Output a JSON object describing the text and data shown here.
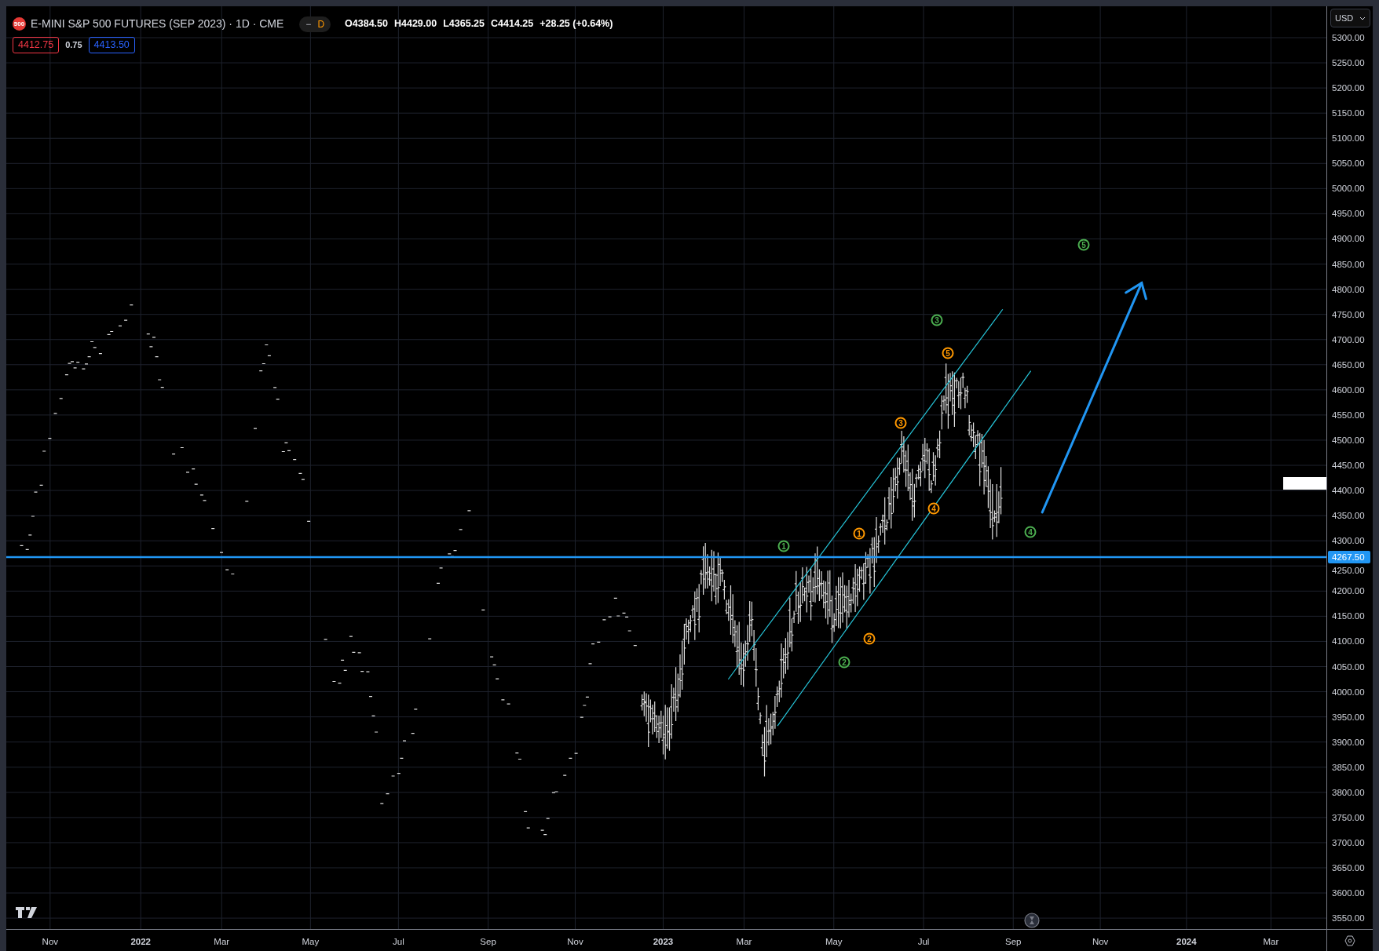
{
  "header": {
    "symbol_badge": "500",
    "title": "E-MINI S&P 500 FUTURES (SEP 2023) · 1D · CME",
    "pill_dash": "−",
    "pill_letter": "D",
    "ohlc": [
      {
        "label": "O",
        "value": "4384.50"
      },
      {
        "label": "H",
        "value": "4429.00"
      },
      {
        "label": "L",
        "value": "4365.25"
      },
      {
        "label": "C",
        "value": "4414.25"
      }
    ],
    "change": "+28.25 (+0.64%)",
    "bid": "4412.75",
    "spread": "0.75",
    "ask": "4413.50"
  },
  "currency": "USD",
  "price_axis": [
    "5300.00",
    "5250.00",
    "5200.00",
    "5150.00",
    "5100.00",
    "5050.00",
    "5000.00",
    "4950.00",
    "4900.00",
    "4850.00",
    "4800.00",
    "4750.00",
    "4700.00",
    "4650.00",
    "4600.00",
    "4550.00",
    "4500.00",
    "4450.00",
    "4400.00",
    "4350.00",
    "4300.00",
    "4250.00",
    "4200.00",
    "4150.00",
    "4100.00",
    "4050.00",
    "4000.00",
    "3950.00",
    "3900.00",
    "3850.00",
    "3800.00",
    "3750.00",
    "3700.00",
    "3650.00",
    "3600.00",
    "3550.00"
  ],
  "price_line_label": "4267.50",
  "time_axis": [
    {
      "label": "Nov",
      "kind": "month"
    },
    {
      "label": "2022",
      "kind": "year"
    },
    {
      "label": "Mar",
      "kind": "month"
    },
    {
      "label": "May",
      "kind": "month"
    },
    {
      "label": "Jul",
      "kind": "month"
    },
    {
      "label": "Sep",
      "kind": "month"
    },
    {
      "label": "Nov",
      "kind": "month"
    },
    {
      "label": "2023",
      "kind": "year"
    },
    {
      "label": "Mar",
      "kind": "month"
    },
    {
      "label": "May",
      "kind": "month"
    },
    {
      "label": "Jul",
      "kind": "month"
    },
    {
      "label": "Sep",
      "kind": "month"
    },
    {
      "label": "Nov",
      "kind": "month"
    },
    {
      "label": "2024",
      "kind": "year"
    },
    {
      "label": "Mar",
      "kind": "month"
    }
  ],
  "wave_labels": [
    {
      "text": "1",
      "color": "#4caf50"
    },
    {
      "text": "2",
      "color": "#4caf50"
    },
    {
      "text": "3",
      "color": "#4caf50"
    },
    {
      "text": "4",
      "color": "#4caf50"
    },
    {
      "text": "5",
      "color": "#4caf50"
    },
    {
      "text": "1",
      "color": "#ff9800"
    },
    {
      "text": "2",
      "color": "#ff9800"
    },
    {
      "text": "3",
      "color": "#ff9800"
    },
    {
      "text": "4",
      "color": "#ff9800"
    },
    {
      "text": "5",
      "color": "#ff9800"
    }
  ]
}
